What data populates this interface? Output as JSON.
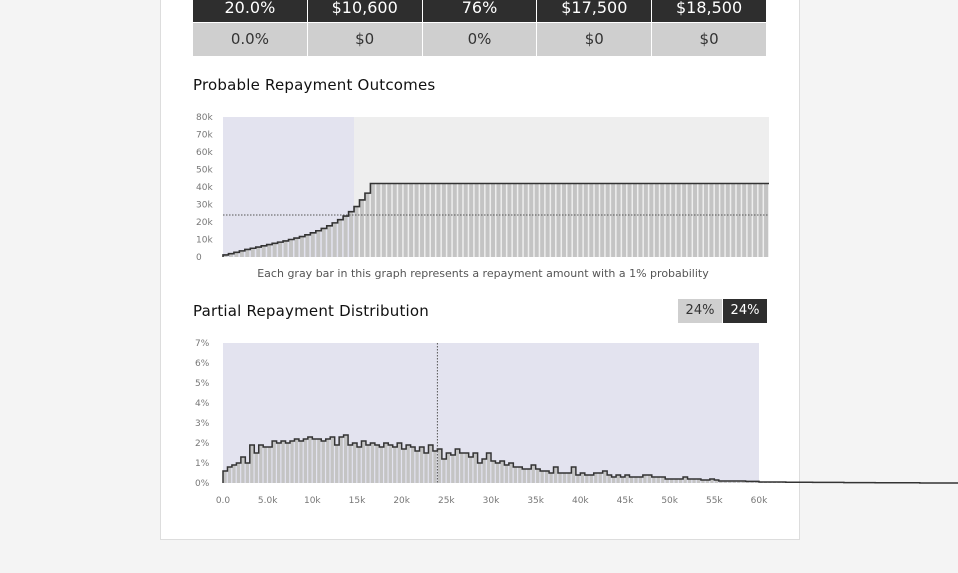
{
  "table": {
    "top_row": [
      "20.0%",
      "$10,600",
      "76%",
      "$17,500",
      "$18,500"
    ],
    "bottom_row": [
      "0.0%",
      "$0",
      "0%",
      "$0",
      "$0"
    ]
  },
  "section1": {
    "title": "Probable Repayment Outcomes"
  },
  "section2": {
    "title": "Partial Repayment Distribution"
  },
  "toggle": {
    "left_label": "24%",
    "right_label": "24%"
  },
  "colors": {
    "dark": "#2e2e2e",
    "bar": "#c4c4c4",
    "highlight": "#e3e3ef",
    "background_fill": "#eeeeee"
  },
  "chart_data": [
    {
      "type": "bar",
      "caption": "Each gray bar in this graph represents a repayment amount with a 1% probability",
      "yticks": [
        "0",
        "10k",
        "20k",
        "30k",
        "40k",
        "50k",
        "60k",
        "70k",
        "80k"
      ],
      "ylim": [
        0,
        80000
      ],
      "shaded_percentiles": 24,
      "reference_line": 24000,
      "x": "percentile (1% each)",
      "values": [
        1200,
        1900,
        2700,
        3500,
        4300,
        5000,
        5700,
        6400,
        7100,
        7800,
        8500,
        9200,
        10000,
        10800,
        11700,
        12700,
        13800,
        15000,
        16300,
        17800,
        19500,
        21300,
        23400,
        25900,
        28800,
        32600,
        36500,
        42000,
        42000,
        42000,
        42000,
        42000,
        42000,
        42000,
        42000,
        42000,
        42000,
        42000,
        42000,
        42000,
        42000,
        42000,
        42000,
        42000,
        42000,
        42000,
        42000,
        42000,
        42000,
        42000,
        42000,
        42000,
        42000,
        42000,
        42000,
        42000,
        42000,
        42000,
        42000,
        42000,
        42000,
        42000,
        42000,
        42000,
        42000,
        42000,
        42000,
        42000,
        42000,
        42000,
        42000,
        42000,
        42000,
        42000,
        42000,
        42000,
        42000,
        42000,
        42000,
        42000,
        42000,
        42000,
        42000,
        42000,
        42000,
        42000,
        42000,
        42000,
        42000,
        42000,
        42000,
        42000,
        42000,
        42000,
        42000,
        42000,
        42000,
        42000,
        42000,
        42000
      ]
    },
    {
      "type": "bar",
      "ylim": [
        0,
        7
      ],
      "yticks": [
        "0%",
        "1%",
        "2%",
        "3%",
        "4%",
        "5%",
        "6%",
        "7%"
      ],
      "xticks": [
        "0.0",
        "5.0k",
        "10k",
        "15k",
        "20k",
        "25k",
        "30k",
        "35k",
        "40k",
        "45k",
        "50k",
        "55k",
        "60k"
      ],
      "xlim": [
        0,
        60000
      ],
      "bin_width": 500,
      "reference_line": 24000,
      "values": [
        0.6,
        0.8,
        0.9,
        1.0,
        1.3,
        1.0,
        1.9,
        1.5,
        1.9,
        1.8,
        1.8,
        2.1,
        2.0,
        2.1,
        2.0,
        2.1,
        2.2,
        2.1,
        2.2,
        2.3,
        2.2,
        2.2,
        2.1,
        2.2,
        2.3,
        1.9,
        2.3,
        2.4,
        1.9,
        2.0,
        1.8,
        2.1,
        1.9,
        2.0,
        1.9,
        1.8,
        2.0,
        1.9,
        1.8,
        2.0,
        1.7,
        1.9,
        1.8,
        1.6,
        1.8,
        1.5,
        1.9,
        1.6,
        1.7,
        1.2,
        1.5,
        1.4,
        1.7,
        1.5,
        1.5,
        1.3,
        1.5,
        1.0,
        1.2,
        1.5,
        1.1,
        1.0,
        1.1,
        0.9,
        1.0,
        0.8,
        0.8,
        0.7,
        0.7,
        0.9,
        0.7,
        0.6,
        0.6,
        0.5,
        0.8,
        0.5,
        0.5,
        0.5,
        0.8,
        0.4,
        0.5,
        0.4,
        0.4,
        0.5,
        0.5,
        0.6,
        0.4,
        0.3,
        0.4,
        0.3,
        0.4,
        0.3,
        0.3,
        0.3,
        0.4,
        0.4,
        0.3,
        0.3,
        0.3,
        0.2,
        0.2,
        0.2,
        0.2,
        0.3,
        0.2,
        0.2,
        0.2,
        0.15,
        0.15,
        0.2,
        0.15,
        0.1,
        0.1,
        0.1,
        0.1,
        0.1,
        0.1,
        0.08,
        0.08,
        0.08,
        0.05,
        0.05,
        0.05,
        0.05,
        0.05,
        0.05,
        0.04,
        0.04,
        0.04,
        0.04,
        0.04,
        0.04,
        0.03,
        0.03,
        0.03,
        0.03,
        0.03,
        0.03,
        0.03,
        0.02,
        0.02,
        0.02,
        0.02,
        0.02,
        0.02,
        0.02,
        0.01,
        0.01,
        0.01,
        0.01,
        0.01,
        0.01,
        0.01,
        0.01,
        0.01,
        0.01,
        0.0,
        0.0,
        0.0,
        0.0,
        0.0,
        0.0,
        0.0,
        0.0,
        0.0,
        0.0
      ]
    }
  ]
}
